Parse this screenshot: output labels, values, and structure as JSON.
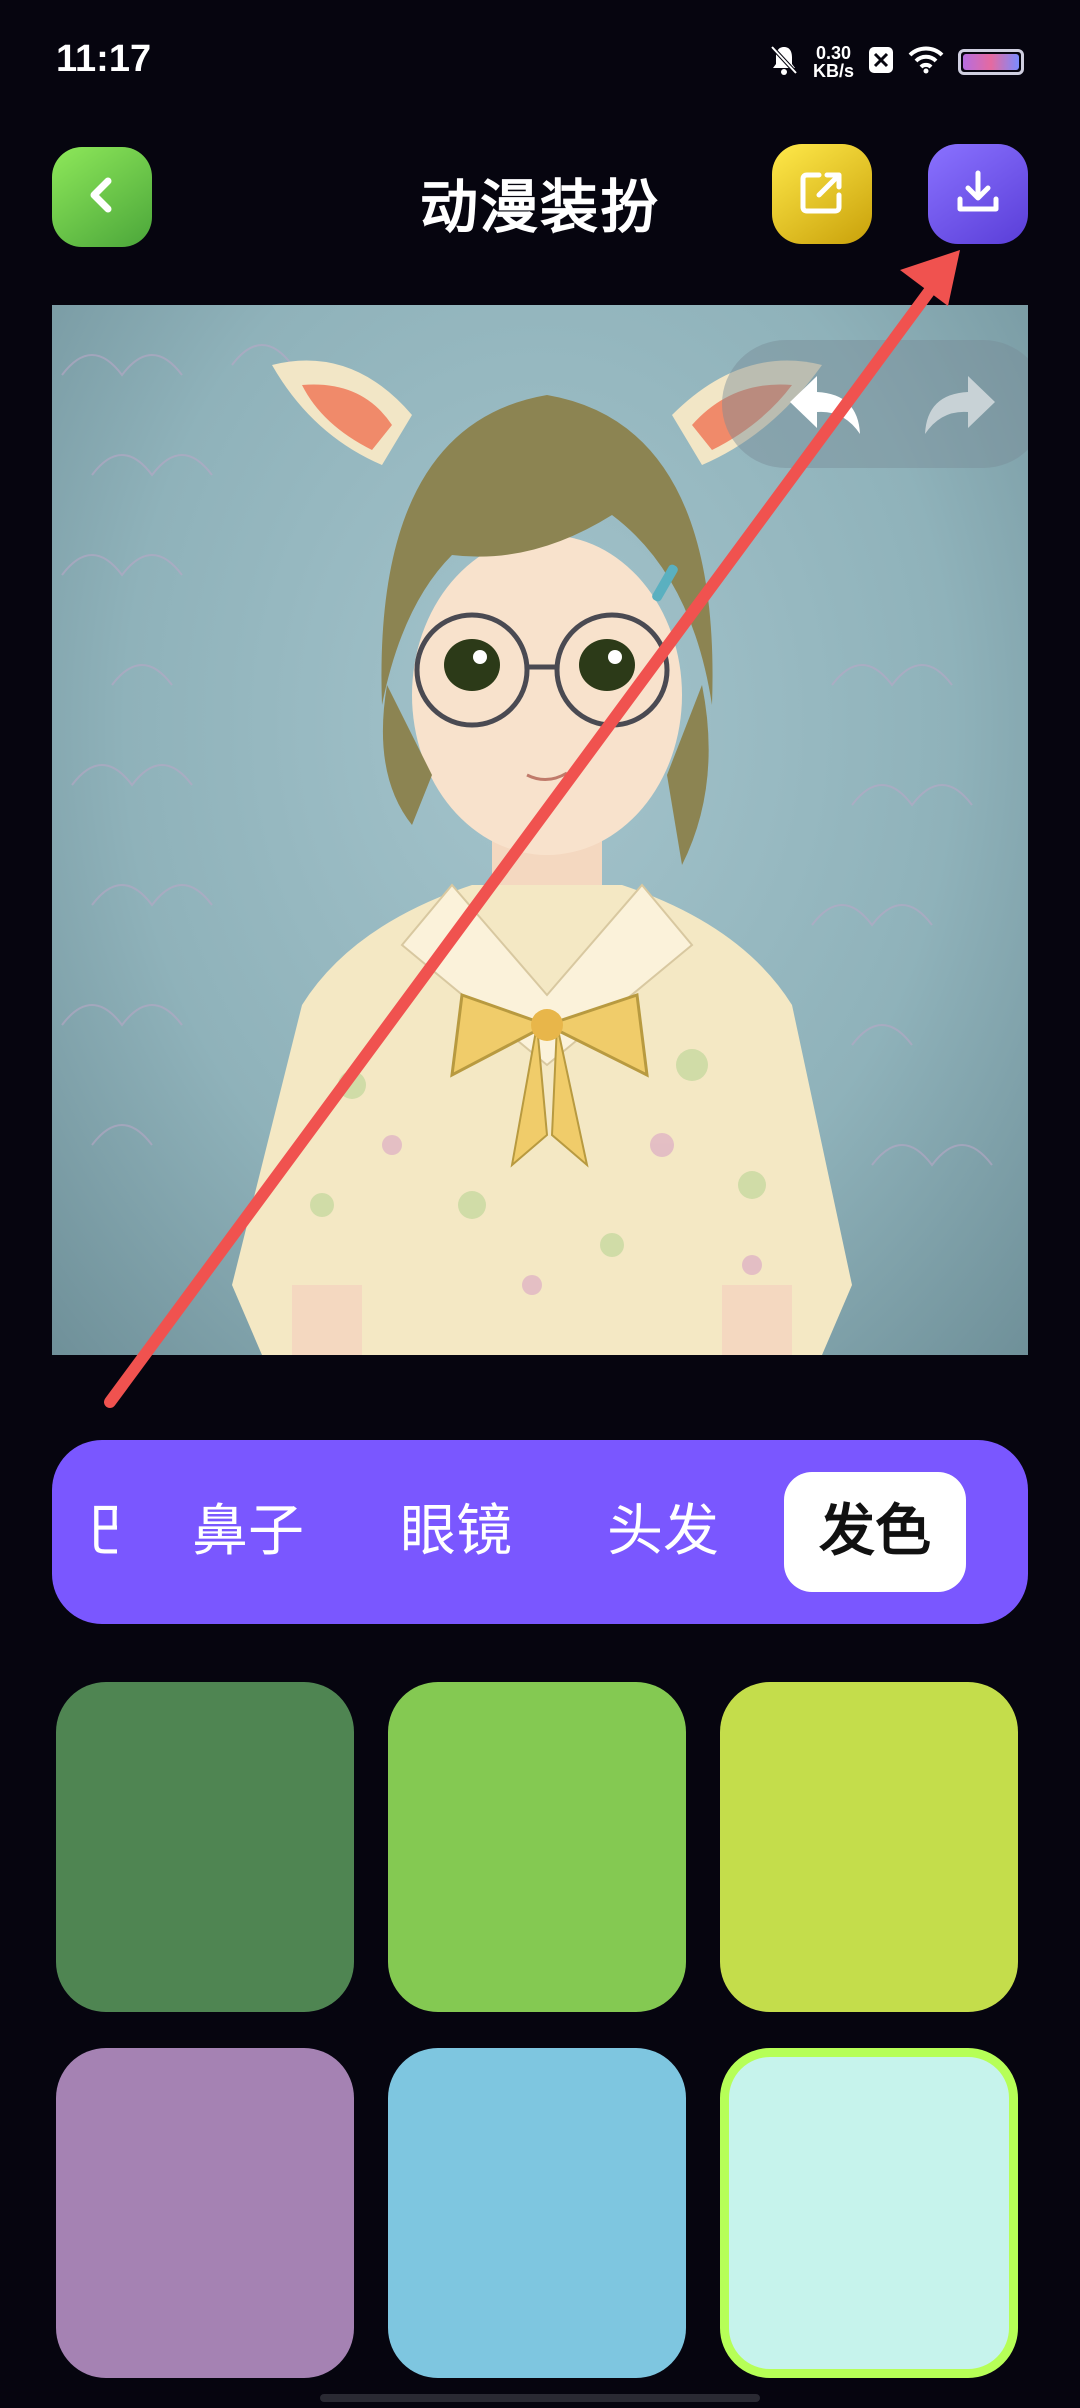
{
  "status_bar": {
    "time": "11:17",
    "net_speed_value": "0.30",
    "net_speed_unit": "KB/s",
    "icons": [
      "bell-mute-icon",
      "close-box-icon",
      "wifi-icon",
      "battery-icon"
    ]
  },
  "header": {
    "title": "动漫装扮",
    "back_icon": "chevron-left-icon",
    "share_icon": "share-icon",
    "download_icon": "download-icon"
  },
  "canvas": {
    "undo_icon": "undo-icon",
    "redo_icon": "redo-icon"
  },
  "categories": [
    {
      "label": "巴",
      "selected": false
    },
    {
      "label": "鼻子",
      "selected": false
    },
    {
      "label": "眼镜",
      "selected": false
    },
    {
      "label": "头发",
      "selected": false
    },
    {
      "label": "发色",
      "selected": true
    }
  ],
  "swatches": [
    {
      "color": "#4f8552",
      "selected": false
    },
    {
      "color": "#84c952",
      "selected": false
    },
    {
      "color": "#c4dd4b",
      "selected": false
    },
    {
      "color": "#a582b3",
      "selected": false
    },
    {
      "color": "#7ec6e0",
      "selected": false
    },
    {
      "color": "#c6f3ec",
      "selected": true
    }
  ],
  "colors": {
    "accent": "#7a57ff",
    "background": "#06050f",
    "selected_border": "#b6ff57",
    "annotation_arrow": "#f0524f"
  }
}
